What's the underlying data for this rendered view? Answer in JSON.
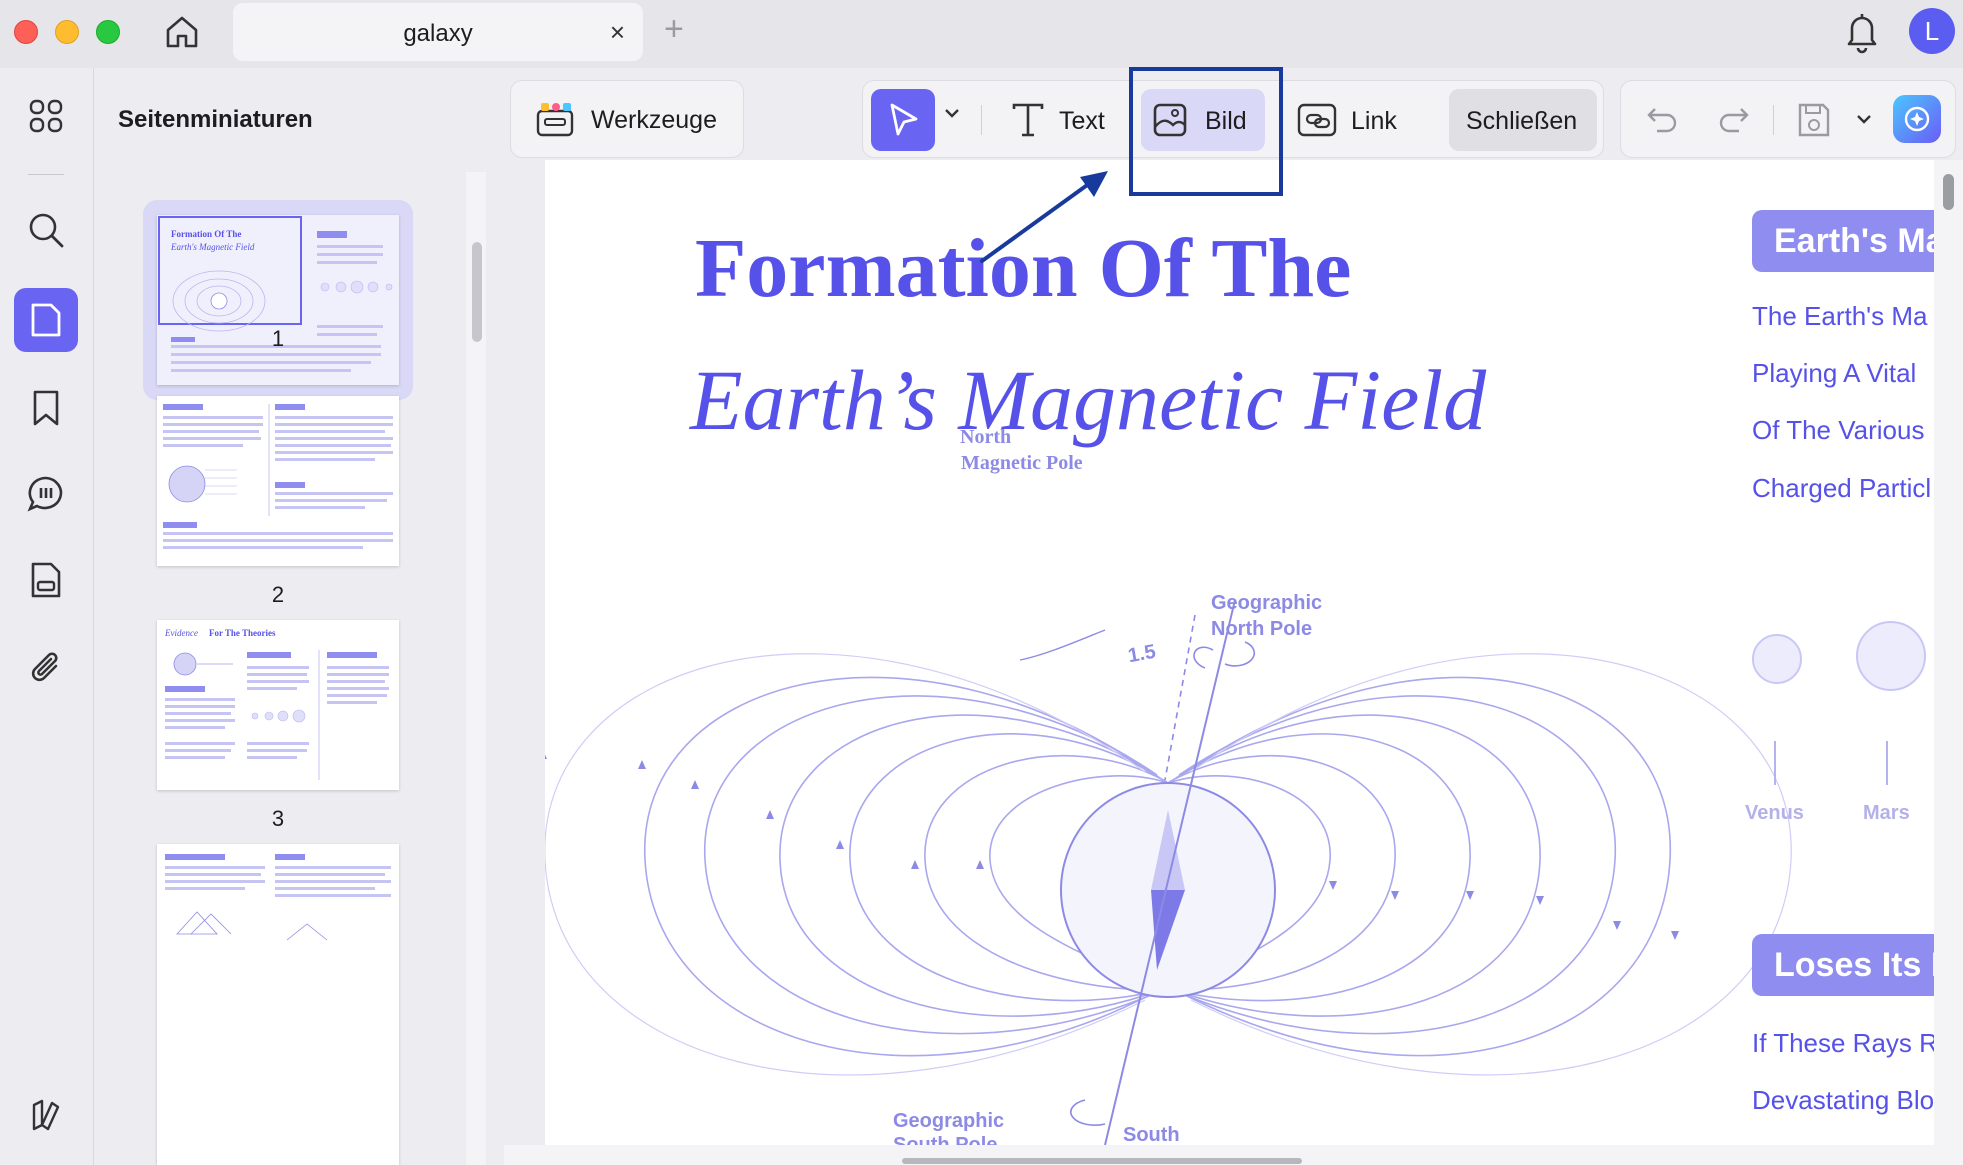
{
  "window": {
    "tab_title": "galaxy",
    "tab_close": "×",
    "new_tab": "+",
    "avatar_letter": "L"
  },
  "rail": {
    "items": [
      "grid-icon",
      "search-icon",
      "page-icon",
      "bookmark-icon",
      "comment-icon",
      "form-icon",
      "attachment-icon",
      "layers-icon"
    ],
    "active": "page-icon"
  },
  "thumbnails": {
    "title": "Seitenminiaturen",
    "pages": [
      "1",
      "2",
      "3"
    ],
    "selected": "1",
    "page1_text": {
      "line1": "Formation Of The",
      "line2": "Earth's Magnetic Field"
    },
    "page3_text": {
      "line1": "Evidence",
      "line2": "For The Theories"
    }
  },
  "toolbar": {
    "tools_label": "Werkzeuge",
    "text_label": "Text",
    "image_label": "Bild",
    "link_label": "Link",
    "close_label": "Schließen"
  },
  "document": {
    "title_line1": "Formation Of The",
    "title_line2": "Earth’s Magnetic Field",
    "figure": {
      "north_magnetic": [
        "North",
        "Magnetic Pole"
      ],
      "geographic_north": [
        "Geographic",
        "North Pole"
      ],
      "angle": "1.5",
      "geographic_south": [
        "Geographic",
        "South Pole"
      ],
      "south": "South"
    },
    "side": {
      "badge1": "Earth's Ma",
      "lines1": [
        "The Earth's Ma",
        "Playing A Vital",
        "Of The Various",
        "Charged Particl"
      ],
      "planets": [
        "Venus",
        "Mars"
      ],
      "badge2": "Loses Its M",
      "lines2": [
        "If These Rays R",
        "Devastating Blo"
      ]
    }
  },
  "colors": {
    "accent": "#6a64f2",
    "title": "#5651e8",
    "highlight_box": "#173a9c",
    "selected_bg": "#d9d8f6"
  }
}
